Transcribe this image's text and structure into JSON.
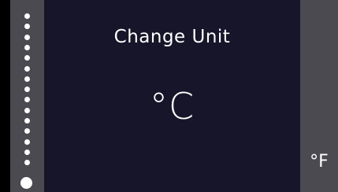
{
  "screen": {
    "title": "Change Unit",
    "current_unit": "°C",
    "next_unit": "°F"
  },
  "pagination": {
    "total": 16,
    "active_index": 15
  },
  "colors": {
    "background": "#000000",
    "main_panel": "#16152a",
    "side_panel": "#4a4a50",
    "text": "#ffffff"
  }
}
